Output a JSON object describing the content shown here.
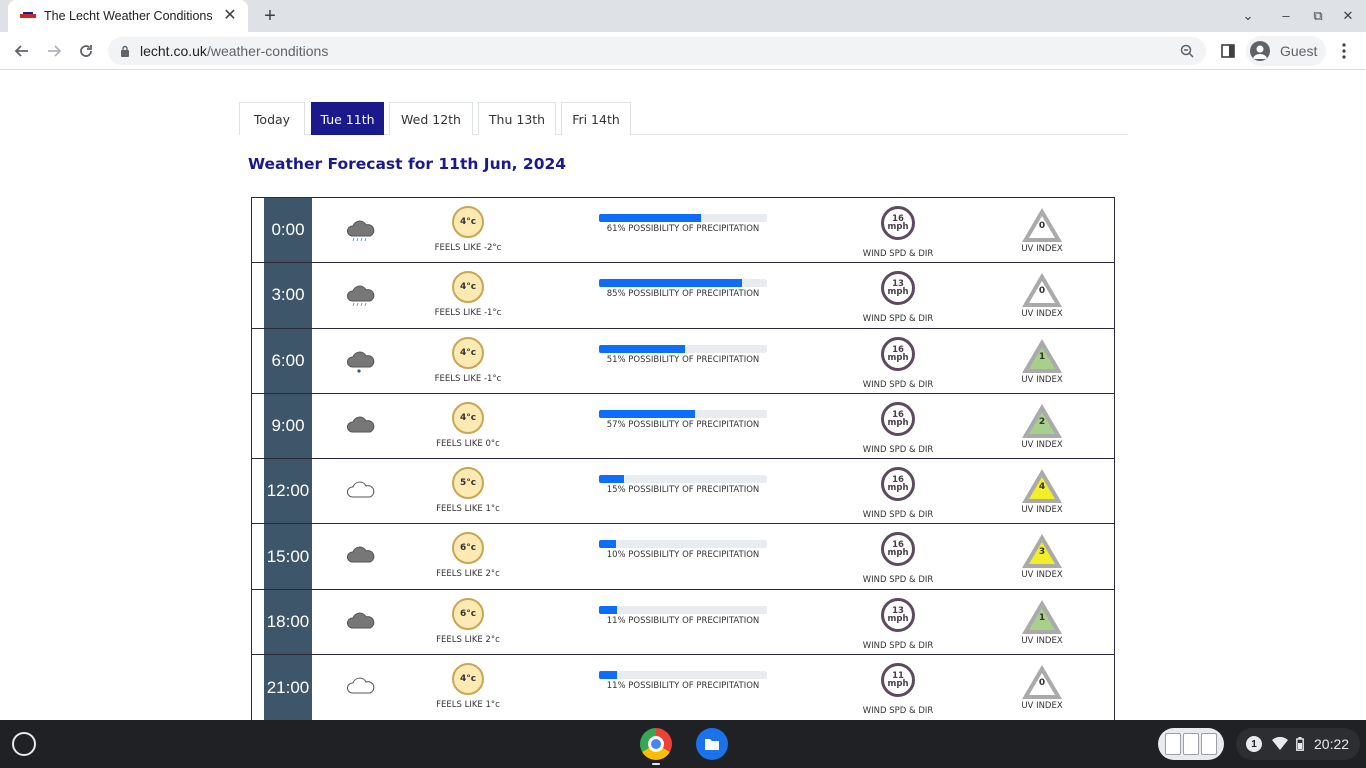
{
  "browser": {
    "tab_title": "The Lecht Weather Conditions",
    "url_host": "lecht.co.uk",
    "url_path": "/weather-conditions",
    "profile_label": "Guest"
  },
  "page": {
    "day_tabs": [
      {
        "label": "Today",
        "active": false
      },
      {
        "label": "Tue 11th",
        "active": true
      },
      {
        "label": "Wed 12th",
        "active": false
      },
      {
        "label": "Thu 13th",
        "active": false
      },
      {
        "label": "Fri 14th",
        "active": false
      }
    ],
    "heading": "Weather Forecast for 11th Jun, 2024",
    "wind_label": "WIND SPD & DIR",
    "uv_label": "UV INDEX",
    "wind_unit": "mph",
    "rows": [
      {
        "time": "0:00",
        "icon": "rain-cloud-icon",
        "temp": "4°c",
        "feels": "FEELS LIKE -2°c",
        "precip": 61,
        "precip_text": "61% POSSIBILITY OF PRECIPITATION",
        "wind": "16",
        "uv": "0",
        "uv_color": "#ffffff"
      },
      {
        "time": "3:00",
        "icon": "rain-cloud-icon",
        "temp": "4°c",
        "feels": "FEELS LIKE -1°c",
        "precip": 85,
        "precip_text": "85% POSSIBILITY OF PRECIPITATION",
        "wind": "13",
        "uv": "0",
        "uv_color": "#ffffff"
      },
      {
        "time": "6:00",
        "icon": "drizzle-cloud-icon",
        "temp": "4°c",
        "feels": "FEELS LIKE -1°c",
        "precip": 51,
        "precip_text": "51% POSSIBILITY OF PRECIPITATION",
        "wind": "16",
        "uv": "1",
        "uv_color": "#a8d08d"
      },
      {
        "time": "9:00",
        "icon": "dark-cloud-icon",
        "temp": "4°c",
        "feels": "FEELS LIKE 0°c",
        "precip": 57,
        "precip_text": "57% POSSIBILITY OF PRECIPITATION",
        "wind": "16",
        "uv": "2",
        "uv_color": "#a8d08d"
      },
      {
        "time": "12:00",
        "icon": "light-cloud-icon",
        "temp": "5°c",
        "feels": "FEELS LIKE 1°c",
        "precip": 15,
        "precip_text": "15% POSSIBILITY OF PRECIPITATION",
        "wind": "16",
        "uv": "4",
        "uv_color": "#f4ee2a"
      },
      {
        "time": "15:00",
        "icon": "dark-cloud-icon",
        "temp": "6°c",
        "feels": "FEELS LIKE 2°c",
        "precip": 10,
        "precip_text": "10% POSSIBILITY OF PRECIPITATION",
        "wind": "16",
        "uv": "3",
        "uv_color": "#f4ee2a"
      },
      {
        "time": "18:00",
        "icon": "dark-cloud-icon",
        "temp": "6°c",
        "feels": "FEELS LIKE 2°c",
        "precip": 11,
        "precip_text": "11% POSSIBILITY OF PRECIPITATION",
        "wind": "13",
        "uv": "1",
        "uv_color": "#a8d08d"
      },
      {
        "time": "21:00",
        "icon": "light-cloud-icon",
        "temp": "4°c",
        "feels": "FEELS LIKE 1°c",
        "precip": 11,
        "precip_text": "11% POSSIBILITY OF PRECIPITATION",
        "wind": "11",
        "uv": "0",
        "uv_color": "#ffffff"
      }
    ]
  },
  "shelf": {
    "notification_count": "1",
    "clock": "20:22"
  }
}
